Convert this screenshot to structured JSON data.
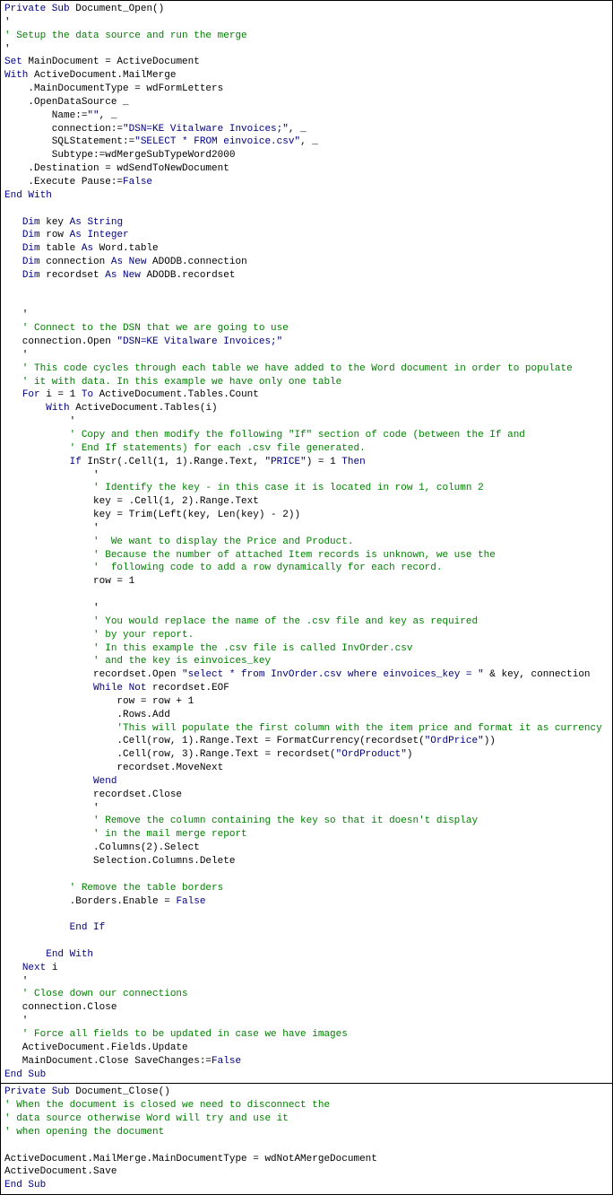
{
  "block1": {
    "lines": [
      [
        [
          "kw",
          "Private Sub"
        ],
        [
          "pl",
          " Document_Open()"
        ]
      ],
      [
        [
          "pl",
          "'"
        ]
      ],
      [
        [
          "cm",
          "' Setup the data source and run the merge"
        ]
      ],
      [
        [
          "pl",
          "'"
        ]
      ],
      [
        [
          "kw",
          "Set"
        ],
        [
          "pl",
          " MainDocument = ActiveDocument"
        ]
      ],
      [
        [
          "kw",
          "With"
        ],
        [
          "pl",
          " ActiveDocument.MailMerge"
        ]
      ],
      [
        [
          "pl",
          "    .MainDocumentType = wdFormLetters"
        ]
      ],
      [
        [
          "pl",
          "    .OpenDataSource _"
        ]
      ],
      [
        [
          "pl",
          "        Name:="
        ],
        [
          "kw",
          "\"\""
        ],
        [
          "pl",
          ", _"
        ]
      ],
      [
        [
          "pl",
          "        connection:="
        ],
        [
          "kw",
          "\"DSN=KE Vitalware Invoices;\""
        ],
        [
          "pl",
          ", _"
        ]
      ],
      [
        [
          "pl",
          "        SQLStatement:="
        ],
        [
          "kw",
          "\"SELECT * FROM einvoice.csv\""
        ],
        [
          "pl",
          ", _"
        ]
      ],
      [
        [
          "pl",
          "        Subtype:=wdMergeSubTypeWord2000"
        ]
      ],
      [
        [
          "pl",
          "    .Destination = wdSendToNewDocument"
        ]
      ],
      [
        [
          "pl",
          "    .Execute Pause:="
        ],
        [
          "kw",
          "False"
        ]
      ],
      [
        [
          "kw",
          "End With"
        ]
      ],
      [
        [
          "pl",
          ""
        ]
      ],
      [
        [
          "pl",
          "   "
        ],
        [
          "kw",
          "Dim"
        ],
        [
          "pl",
          " key "
        ],
        [
          "kw",
          "As String"
        ]
      ],
      [
        [
          "pl",
          "   "
        ],
        [
          "kw",
          "Dim"
        ],
        [
          "pl",
          " row "
        ],
        [
          "kw",
          "As Integer"
        ]
      ],
      [
        [
          "pl",
          "   "
        ],
        [
          "kw",
          "Dim"
        ],
        [
          "pl",
          " table "
        ],
        [
          "kw",
          "As"
        ],
        [
          "pl",
          " Word.table"
        ]
      ],
      [
        [
          "pl",
          "   "
        ],
        [
          "kw",
          "Dim"
        ],
        [
          "pl",
          " connection "
        ],
        [
          "kw",
          "As New"
        ],
        [
          "pl",
          " ADODB.connection"
        ]
      ],
      [
        [
          "pl",
          "   "
        ],
        [
          "kw",
          "Dim"
        ],
        [
          "pl",
          " recordset "
        ],
        [
          "kw",
          "As New"
        ],
        [
          "pl",
          " ADODB.recordset"
        ]
      ],
      [
        [
          "pl",
          ""
        ]
      ],
      [
        [
          "pl",
          ""
        ]
      ],
      [
        [
          "pl",
          "   '"
        ]
      ],
      [
        [
          "cm",
          "   ' Connect to the DSN that we are going to use"
        ]
      ],
      [
        [
          "pl",
          "   connection.Open "
        ],
        [
          "kw",
          "\"DSN=KE Vitalware Invoices;\""
        ]
      ],
      [
        [
          "pl",
          "   '"
        ]
      ],
      [
        [
          "cm",
          "   ' This code cycles through each table we have added to the Word document in order to populate"
        ]
      ],
      [
        [
          "cm",
          "   ' it with data. In this example we have only one table"
        ]
      ],
      [
        [
          "pl",
          "   "
        ],
        [
          "kw",
          "For"
        ],
        [
          "pl",
          " i = 1 "
        ],
        [
          "kw",
          "To"
        ],
        [
          "pl",
          " ActiveDocument.Tables.Count"
        ]
      ],
      [
        [
          "pl",
          "       "
        ],
        [
          "kw",
          "With"
        ],
        [
          "pl",
          " ActiveDocument.Tables(i)"
        ]
      ],
      [
        [
          "pl",
          "           '"
        ]
      ],
      [
        [
          "cm",
          "           ' Copy and then modify the following \"If\" section of code (between the If and"
        ]
      ],
      [
        [
          "cm",
          "           ' End If statements) for each .csv file generated."
        ]
      ],
      [
        [
          "pl",
          "           "
        ],
        [
          "kw",
          "If"
        ],
        [
          "pl",
          " InStr(.Cell(1, 1).Range.Text, "
        ],
        [
          "kw",
          "\"PRICE\""
        ],
        [
          "pl",
          ") = 1 "
        ],
        [
          "kw",
          "Then"
        ]
      ],
      [
        [
          "pl",
          "               '"
        ]
      ],
      [
        [
          "cm",
          "               ' Identify the key - in this case it is located in row 1, column 2"
        ]
      ],
      [
        [
          "pl",
          "               key = .Cell(1, 2).Range.Text"
        ]
      ],
      [
        [
          "pl",
          "               key = Trim(Left(key, Len(key) - 2))"
        ]
      ],
      [
        [
          "pl",
          "               '"
        ]
      ],
      [
        [
          "cm",
          "               '  We want to display the Price and Product."
        ]
      ],
      [
        [
          "cm",
          "               ' Because the number of attached Item records is unknown, we use the"
        ]
      ],
      [
        [
          "cm",
          "               '  following code to add a row dynamically for each record."
        ]
      ],
      [
        [
          "pl",
          "               row = 1"
        ]
      ],
      [
        [
          "pl",
          ""
        ]
      ],
      [
        [
          "pl",
          "               '"
        ]
      ],
      [
        [
          "cm",
          "               ' You would replace the name of the .csv file and key as required"
        ]
      ],
      [
        [
          "cm",
          "               ' by your report."
        ]
      ],
      [
        [
          "cm",
          "               ' In this example the .csv file is called InvOrder.csv"
        ]
      ],
      [
        [
          "cm",
          "               ' and the key is einvoices_key"
        ]
      ],
      [
        [
          "pl",
          "               recordset.Open "
        ],
        [
          "kw",
          "\"select * from InvOrder.csv where einvoices_key = \""
        ],
        [
          "pl",
          " & key, connection"
        ]
      ],
      [
        [
          "pl",
          "               "
        ],
        [
          "kw",
          "While Not"
        ],
        [
          "pl",
          " recordset.EOF"
        ]
      ],
      [
        [
          "pl",
          "                   row = row + 1"
        ]
      ],
      [
        [
          "pl",
          "                   .Rows.Add"
        ]
      ],
      [
        [
          "cm",
          "                   'This will populate the first column with the item price and format it as currency"
        ]
      ],
      [
        [
          "pl",
          "                   .Cell(row, 1).Range.Text = FormatCurrency(recordset("
        ],
        [
          "kw",
          "\"OrdPrice\""
        ],
        [
          "pl",
          "))"
        ]
      ],
      [
        [
          "pl",
          "                   .Cell(row, 3).Range.Text = recordset("
        ],
        [
          "kw",
          "\"OrdProduct\""
        ],
        [
          "pl",
          ")"
        ]
      ],
      [
        [
          "pl",
          "                   recordset.MoveNext"
        ]
      ],
      [
        [
          "pl",
          "               "
        ],
        [
          "kw",
          "Wend"
        ]
      ],
      [
        [
          "pl",
          "               recordset.Close"
        ]
      ],
      [
        [
          "pl",
          "               '"
        ]
      ],
      [
        [
          "cm",
          "               ' Remove the column containing the key so that it doesn't display"
        ]
      ],
      [
        [
          "cm",
          "               ' in the mail merge report"
        ]
      ],
      [
        [
          "pl",
          "               .Columns(2).Select"
        ]
      ],
      [
        [
          "pl",
          "               Selection.Columns.Delete"
        ]
      ],
      [
        [
          "pl",
          ""
        ]
      ],
      [
        [
          "cm",
          "           ' Remove the table borders"
        ]
      ],
      [
        [
          "pl",
          "           .Borders.Enable = "
        ],
        [
          "kw",
          "False"
        ]
      ],
      [
        [
          "pl",
          ""
        ]
      ],
      [
        [
          "pl",
          "           "
        ],
        [
          "kw",
          "End If"
        ]
      ],
      [
        [
          "pl",
          ""
        ]
      ],
      [
        [
          "pl",
          "       "
        ],
        [
          "kw",
          "End With"
        ]
      ],
      [
        [
          "pl",
          "   "
        ],
        [
          "kw",
          "Next"
        ],
        [
          "pl",
          " i"
        ]
      ],
      [
        [
          "pl",
          "   '"
        ]
      ],
      [
        [
          "cm",
          "   ' Close down our connections"
        ]
      ],
      [
        [
          "pl",
          "   connection.Close"
        ]
      ],
      [
        [
          "pl",
          "   '"
        ]
      ],
      [
        [
          "cm",
          "   ' Force all fields to be updated in case we have images"
        ]
      ],
      [
        [
          "pl",
          "   ActiveDocument.Fields.Update"
        ]
      ],
      [
        [
          "pl",
          "   MainDocument.Close SaveChanges:="
        ],
        [
          "kw",
          "False"
        ]
      ],
      [
        [
          "kw",
          "End Sub"
        ]
      ]
    ]
  },
  "block2": {
    "lines": [
      [
        [
          "kw",
          "Private Sub"
        ],
        [
          "pl",
          " Document_Close()"
        ]
      ],
      [
        [
          "cm",
          "' When the document is closed we need to disconnect the"
        ]
      ],
      [
        [
          "cm",
          "' data source otherwise Word will try and use it"
        ]
      ],
      [
        [
          "cm",
          "' when opening the document"
        ]
      ],
      [
        [
          "pl",
          ""
        ]
      ],
      [
        [
          "pl",
          "ActiveDocument.MailMerge.MainDocumentType = wdNotAMergeDocument"
        ]
      ],
      [
        [
          "pl",
          "ActiveDocument.Save"
        ]
      ],
      [
        [
          "kw",
          "End Sub"
        ]
      ]
    ]
  }
}
